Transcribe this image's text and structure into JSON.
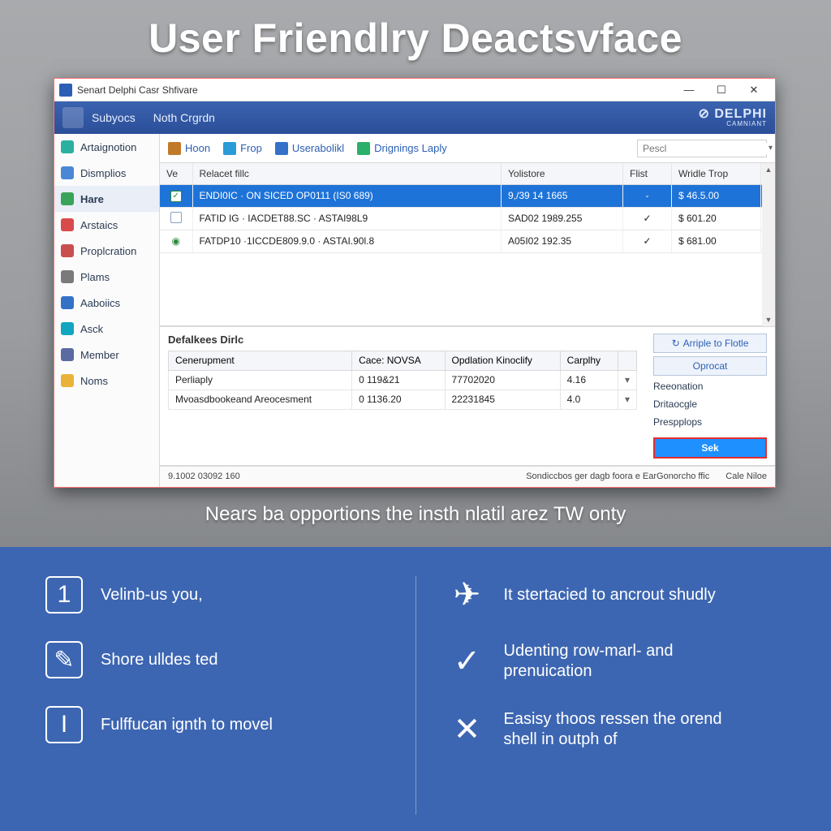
{
  "hero": {
    "title": "User Friendlry Deactsvface"
  },
  "window": {
    "title": "Senart Delphi Casr Shfivare",
    "ribbon": {
      "tabs": [
        "Subyocs",
        "Noth Crgrdn"
      ],
      "brand": "DELPHI",
      "brand_sub": "CAMNIANT"
    },
    "sidebar": {
      "items": [
        {
          "label": "Artaignotion",
          "color": "#2bb0a0"
        },
        {
          "label": "Dismplios",
          "color": "#4a88d6"
        },
        {
          "label": "Hare",
          "color": "#3aa35a",
          "active": true
        },
        {
          "label": "Arstaics",
          "color": "#d94b4b"
        },
        {
          "label": "Proplcration",
          "color": "#c94f4f"
        },
        {
          "label": "Plams",
          "color": "#7a7a7a"
        },
        {
          "label": "Aaboiics",
          "color": "#3571c6"
        },
        {
          "label": "Asck",
          "color": "#12a5c0"
        },
        {
          "label": "Member",
          "color": "#5b6aa0"
        },
        {
          "label": "Noms",
          "color": "#e9b33a"
        }
      ]
    },
    "toolbar": {
      "items": [
        {
          "label": "Hoon",
          "color": "#c07a2a"
        },
        {
          "label": "Frop",
          "color": "#2b9bd8"
        },
        {
          "label": "Userabolikl",
          "color": "#3571c6"
        },
        {
          "label": "Drignings Laply",
          "color": "#2bb06a"
        }
      ],
      "search_placeholder": "Pescl"
    },
    "grid": {
      "columns": [
        "Ve",
        "Relacet fillc",
        "Yolistore",
        "Flist",
        "Wridle Trop"
      ],
      "rows": [
        {
          "ve": "check",
          "c1": "ENDI0IC · ON SICED OP0111 (IS0 689)",
          "c2": "9,/39 14 1665",
          "c3": "-",
          "c4": "$ 46.5.00",
          "selected": true
        },
        {
          "ve": "box",
          "c1": "FATID IG · IACDET88.SC · ASTAI98L9",
          "c2": "SAD02 1989.255",
          "c3": "✓",
          "c4": "$ 601.20"
        },
        {
          "ve": "target",
          "c1": "FATDP10 ·1ICCDE809.9.0 · ASTAI.90l.8",
          "c2": "A05I02 192.35",
          "c3": "✓",
          "c4": "$ 681.00"
        }
      ]
    },
    "detail": {
      "title": "Defalkees Dirlc",
      "columns": [
        "Cenerupment",
        "Cace:  NOVSA",
        "Opdlation  Kinoclify",
        "Carplhy"
      ],
      "rows": [
        {
          "c0": "Perliaply",
          "c1": "0    119&21",
          "c2": "77702020",
          "c3": "4.16"
        },
        {
          "c0": "Mvoasdbookeand Areocesment",
          "c1": "0    1136.20",
          "c2": "22231845",
          "c3": "4.0"
        }
      ],
      "actions": {
        "btn1": "Arriple to Flotle",
        "btn2": "Oprocat",
        "links": [
          "Reeonation",
          "Dritaocgle",
          "Prespplops"
        ],
        "primary": "Sek"
      }
    },
    "status": {
      "left": "9.1002 03092 160",
      "mid": "Sondiccbos ger dagb foora e EarGonorcho ffic",
      "right": "Cale Niloe"
    }
  },
  "subheadline": "Nears ba opportions the insth nlatil arez TW onty",
  "features": {
    "left": [
      {
        "icon": "1",
        "label": "Velinb-us you,"
      },
      {
        "icon": "✎",
        "label": "Shore ulldes ted"
      },
      {
        "icon": "I",
        "label": "Fulffucan ignth to movel"
      }
    ],
    "right": [
      {
        "icon": "✈",
        "label": "It stertacied to ancrout shudly"
      },
      {
        "icon": "✓",
        "label": "Udenting row-marl- and prenuication"
      },
      {
        "icon": "✕",
        "label": "Easisy thoos ressen the orend shell in outph of"
      }
    ]
  }
}
